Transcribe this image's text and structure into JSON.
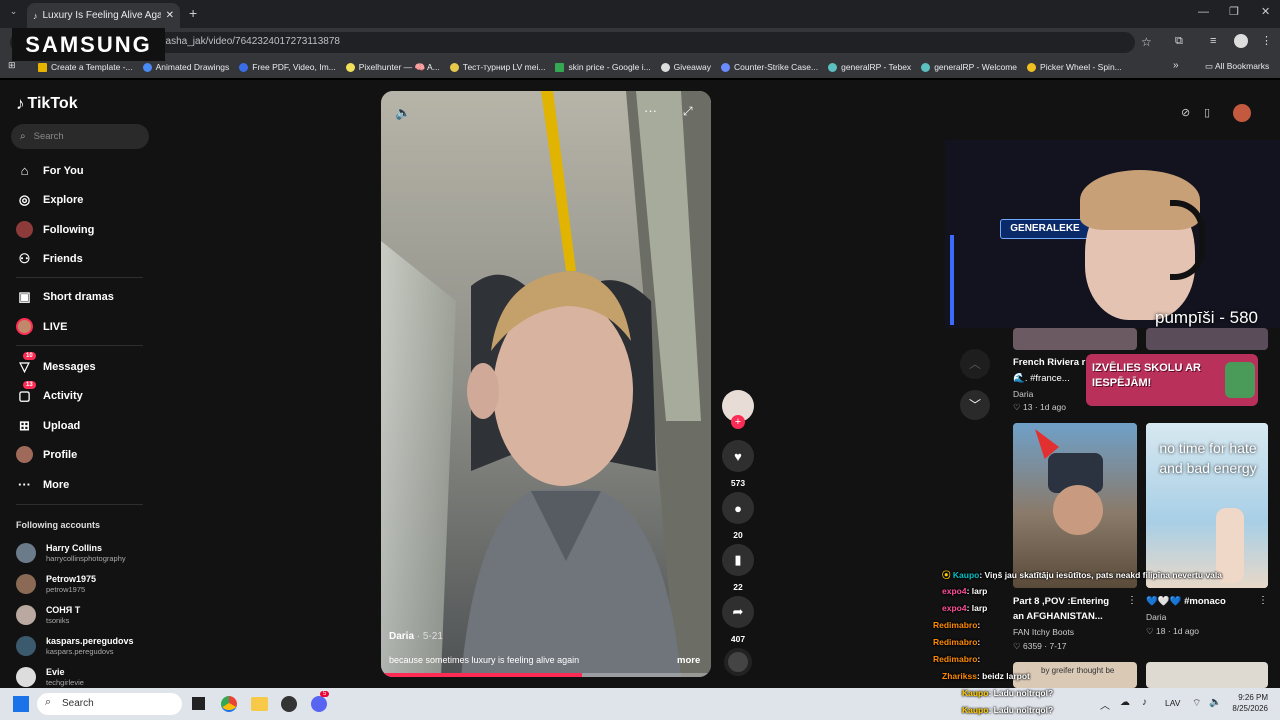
{
  "browser": {
    "tab_title": "Luxury Is Feeling Alive Again | T",
    "url": "dasha_jak/video/7642324017273113878",
    "bookmarks": [
      "Create a Template -...",
      "Animated Drawings",
      "Free PDF, Video, Im...",
      "Pixelhunter — 🧠 A...",
      "Тест-турнир LV mei...",
      "skin price - Google i...",
      "Giveaway",
      "Counter-Strike Case...",
      "generalRP - Tebex",
      "generalRP - Welcome",
      "Picker Wheel - Spin..."
    ],
    "all_bookmarks": "All Bookmarks"
  },
  "overlay": {
    "samsung": "SAMSUNG",
    "webcam_label": "GENERALEKE",
    "counter": "pumpīši - 580"
  },
  "sidebar": {
    "logo": "TikTok",
    "search_placeholder": "Search",
    "nav": [
      {
        "label": "For You",
        "icon": "home-icon"
      },
      {
        "label": "Explore",
        "icon": "compass-icon"
      },
      {
        "label": "Following",
        "icon": "following-avatar-icon"
      },
      {
        "label": "Friends",
        "icon": "friends-icon"
      },
      {
        "label": "Short dramas",
        "icon": "film-icon"
      },
      {
        "label": "LIVE",
        "icon": "live-icon"
      },
      {
        "label": "Messages",
        "icon": "messages-icon",
        "badge": "10"
      },
      {
        "label": "Activity",
        "icon": "activity-icon",
        "badge": "13"
      },
      {
        "label": "Upload",
        "icon": "upload-icon"
      },
      {
        "label": "Profile",
        "icon": "profile-avatar-icon"
      },
      {
        "label": "More",
        "icon": "more-icon"
      }
    ],
    "following_title": "Following accounts",
    "accounts": [
      {
        "name": "Harry Collins",
        "handle": "harrycollinsphotography",
        "color": "#6b7b8a"
      },
      {
        "name": "Petrow1975",
        "handle": "petrow1975",
        "color": "#8a6a55"
      },
      {
        "name": "СОНЯ Т",
        "handle": "tsoniks",
        "color": "#b9a9a0"
      },
      {
        "name": "kaspars.peregudovs",
        "handle": "kaspars.peregudovs",
        "color": "#3c5a6e"
      },
      {
        "name": "Evie",
        "handle": "techgirlevie",
        "color": "#ddd"
      }
    ]
  },
  "video": {
    "author": "Daria",
    "date": "5-21",
    "caption": "because sometimes luxury is feeling alive again",
    "more": "more",
    "progress": 0.61,
    "likes": "573",
    "comments": "20",
    "saves": "22",
    "shares": "407"
  },
  "right": {
    "items": [
      {
        "title": "French Riviera r",
        "tags": "🌊. #france...",
        "author": "Daria",
        "views": "13",
        "age": "1d ago"
      },
      {
        "title": "Part 8 ,POV :Entering",
        "title2": "an AFGHANISTAN...",
        "author": "FAN Itchy Boots",
        "views": "6359",
        "age": "7-17"
      },
      {
        "title": "💙🤍💙 #monaco",
        "author": "Daria",
        "views": "18",
        "age": "1d ago"
      }
    ],
    "ad_text": "IZVĒLIES SKOLU AR IESPĒJĀM!",
    "thumb_text": "no time for hate and bad energy",
    "thumb_bottom": "by greifer thought be"
  },
  "chat": [
    {
      "user": "Kaupo",
      "msg": ": Viņš jau skatītāju iesūtītos, pats neakd filipīna nevertu vala",
      "color": "#00c2c7"
    },
    {
      "user": "expo4",
      "msg": ": larp",
      "color": "#ff4f9a"
    },
    {
      "user": "expo4",
      "msg": ": larp",
      "color": "#ff4f9a"
    },
    {
      "user": "Redimabro",
      "msg": ":",
      "color": "#ff8a00"
    },
    {
      "user": "Redimabro",
      "msg": ":",
      "color": "#ff8a00"
    },
    {
      "user": "Redimabro",
      "msg": ":",
      "color": "#ff8a00"
    },
    {
      "user": "Zharikss",
      "msg": ": beidz larpot",
      "color": "#ff8a00"
    },
    {
      "user": "Kaupo",
      "msg": ": Ladu noltrqol?",
      "color": "#ffcc00"
    },
    {
      "user": "Kaupo",
      "msg": ": Ladu noltrqol?",
      "color": "#ffcc00"
    }
  ],
  "taskbar": {
    "search": "Search",
    "lang": "LAV",
    "time": "9:26 PM",
    "date": "8/25/2026",
    "discord_badge": "5"
  }
}
